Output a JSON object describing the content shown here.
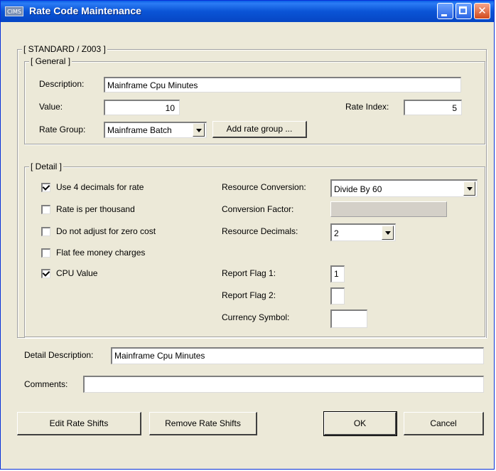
{
  "window": {
    "title": "Rate Code Maintenance",
    "app_icon_text": "CIMS",
    "close_glyph": "✕"
  },
  "outer_group": {
    "label": "[ STANDARD / Z003    ]"
  },
  "general": {
    "label": "[ General ]",
    "description_label": "Description:",
    "description_value": "Mainframe Cpu Minutes",
    "value_label": "Value:",
    "value_value": "10",
    "rate_index_label": "Rate Index:",
    "rate_index_value": "5",
    "rate_group_label": "Rate Group:",
    "rate_group_value": "Mainframe Batch",
    "add_rate_group_label": "Add rate group ..."
  },
  "detail": {
    "label": "[ Detail ]",
    "checkboxes": [
      {
        "label": "Use 4 decimals for rate",
        "checked": true
      },
      {
        "label": "Rate is per thousand",
        "checked": false
      },
      {
        "label": "Do not adjust for zero cost",
        "checked": false
      },
      {
        "label": "Flat fee money charges",
        "checked": false
      },
      {
        "label": "CPU Value",
        "checked": true
      }
    ],
    "resource_conversion_label": "Resource Conversion:",
    "resource_conversion_value": "Divide By 60",
    "conversion_factor_label": "Conversion Factor:",
    "conversion_factor_value": "",
    "resource_decimals_label": "Resource Decimals:",
    "resource_decimals_value": "2",
    "report_flag1_label": "Report Flag 1:",
    "report_flag1_value": "1",
    "report_flag2_label": "Report Flag 2:",
    "report_flag2_value": "",
    "currency_symbol_label": "Currency Symbol:",
    "currency_symbol_value": ""
  },
  "bottom": {
    "detail_description_label": "Detail Description:",
    "detail_description_value": "Mainframe Cpu Minutes",
    "comments_label": "Comments:",
    "comments_value": ""
  },
  "buttons": {
    "edit_rate_shifts": "Edit Rate Shifts",
    "remove_rate_shifts": "Remove Rate Shifts",
    "ok": "OK",
    "cancel": "Cancel"
  }
}
